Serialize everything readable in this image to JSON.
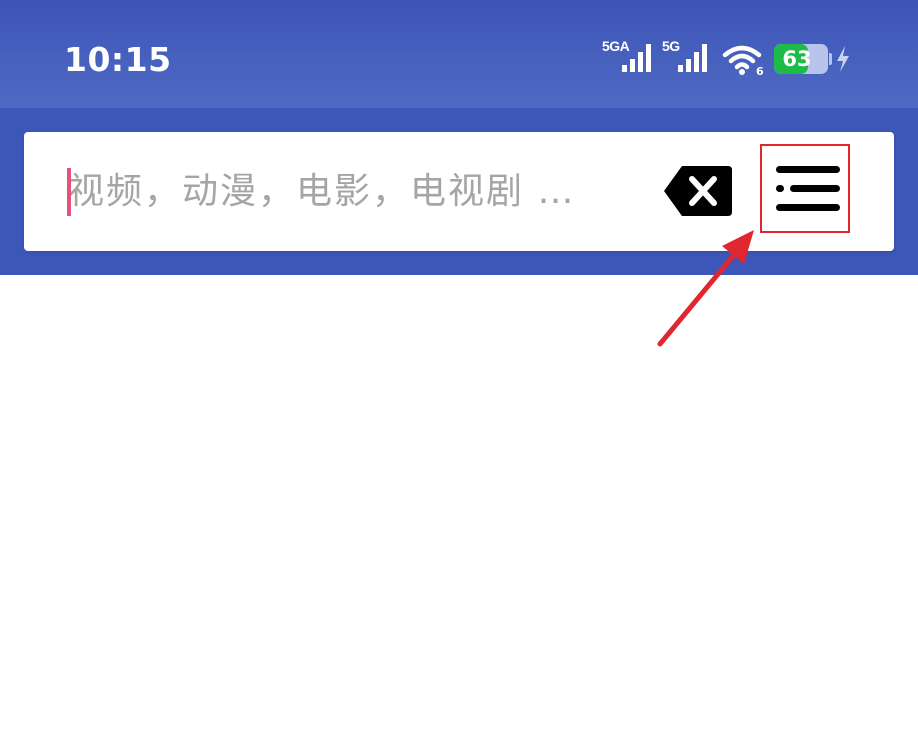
{
  "status_bar": {
    "time": "10:15",
    "signal_1_label": "5GA",
    "signal_2_label": "5G",
    "wifi_badge": "6",
    "battery_percent": 63,
    "battery_text": "63",
    "charging": true
  },
  "search": {
    "placeholder": "视频，动漫，电影，电视剧 …",
    "value": ""
  },
  "icons": {
    "clear": "backspace-clear-icon",
    "menu": "menu-list-icon"
  },
  "colors": {
    "header_bg": "#3d57b8",
    "battery_green": "#1fbb49",
    "caret": "#e8507b",
    "annotation_red": "#e0262e"
  }
}
